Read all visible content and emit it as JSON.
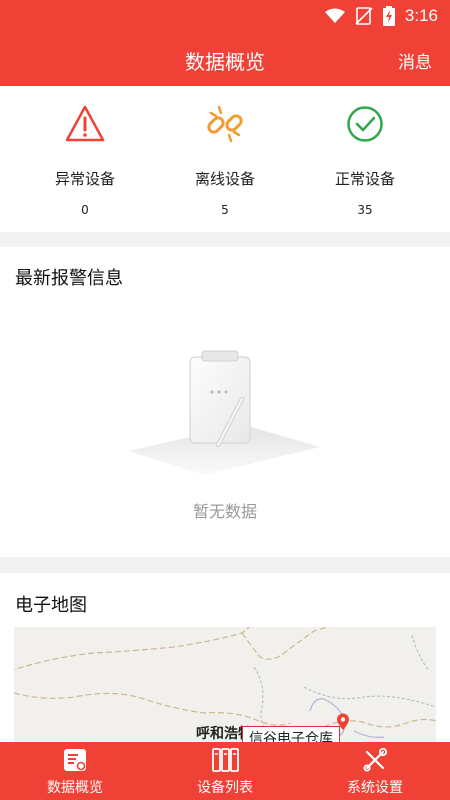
{
  "status_bar": {
    "time": "3:16"
  },
  "header": {
    "title": "数据概览",
    "action": "消息"
  },
  "stats": [
    {
      "label": "异常设备",
      "value": "0",
      "icon": "warning-icon",
      "color": "#ef4136"
    },
    {
      "label": "离线设备",
      "value": "5",
      "icon": "broken-link-icon",
      "color": "#f39c34"
    },
    {
      "label": "正常设备",
      "value": "35",
      "icon": "check-circle-icon",
      "color": "#2ea84a"
    }
  ],
  "alerts": {
    "title": "最新报警信息",
    "empty_text": "暂无数据"
  },
  "map": {
    "title": "电子地图",
    "city_label": "呼和浩特",
    "marker_label": "信谷电子仓库"
  },
  "nav": [
    {
      "label": "数据概览",
      "icon": "overview-icon",
      "active": true
    },
    {
      "label": "设备列表",
      "icon": "device-list-icon",
      "active": false
    },
    {
      "label": "系统设置",
      "icon": "settings-tools-icon",
      "active": false
    }
  ],
  "colors": {
    "primary": "#ef4136",
    "background": "#f2f2f2"
  }
}
